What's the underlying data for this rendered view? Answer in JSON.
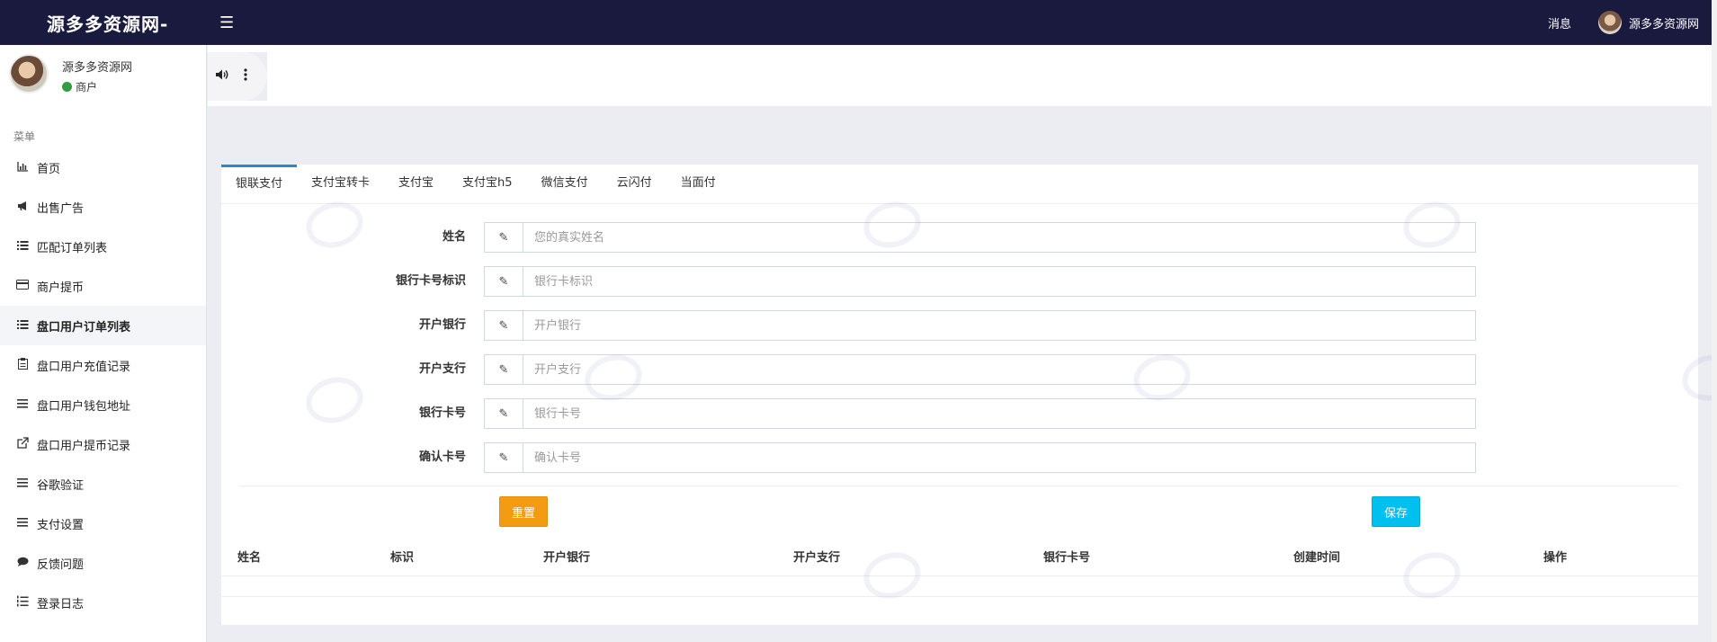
{
  "topbar": {
    "brand": "源多多资源网-",
    "menu_icon": "hamburger-icon",
    "messages": "消息",
    "username": "源多多资源网"
  },
  "sidebar": {
    "user_name": "源多多资源网",
    "user_role": "商户",
    "status_color": "#2e9e3f",
    "menu_header": "菜单",
    "items": [
      {
        "label": "首页",
        "icon": "bar-chart-icon"
      },
      {
        "label": "出售广告",
        "icon": "bullhorn-icon"
      },
      {
        "label": "匹配订单列表",
        "icon": "list-icon"
      },
      {
        "label": "商户提币",
        "icon": "credit-card-icon"
      },
      {
        "label": "盘口用户订单列表",
        "icon": "list-icon"
      },
      {
        "label": "盘口用户充值记录",
        "icon": "clipboard-icon"
      },
      {
        "label": "盘口用户钱包地址",
        "icon": "bars-icon"
      },
      {
        "label": "盘口用户提币记录",
        "icon": "external-link-icon"
      },
      {
        "label": "谷歌验证",
        "icon": "bars-icon"
      },
      {
        "label": "支付设置",
        "icon": "bars-icon"
      },
      {
        "label": "反馈问题",
        "icon": "comment-icon"
      },
      {
        "label": "登录日志",
        "icon": "list-ol-icon"
      }
    ]
  },
  "tabs": [
    "银联支付",
    "支付宝转卡",
    "支付宝",
    "支付宝h5",
    "微信支付",
    "云闪付",
    "当面付"
  ],
  "form": {
    "fields": [
      {
        "label": "姓名",
        "placeholder": "您的真实姓名"
      },
      {
        "label": "银行卡号标识",
        "placeholder": "银行卡标识"
      },
      {
        "label": "开户银行",
        "placeholder": "开户银行"
      },
      {
        "label": "开户支行",
        "placeholder": "开户支行"
      },
      {
        "label": "银行卡号",
        "placeholder": "银行卡号"
      },
      {
        "label": "确认卡号",
        "placeholder": "确认卡号"
      }
    ],
    "reset_label": "重置",
    "save_label": "保存"
  },
  "table": {
    "columns": [
      "姓名",
      "标识",
      "开户银行",
      "开户支行",
      "银行卡号",
      "创建时间",
      "操作"
    ],
    "rows": []
  },
  "colors": {
    "navbar": "#1a1a3e",
    "tab_accent": "#2b8ac5",
    "reset_button": "#f39c12",
    "save_button": "#00c0ef"
  }
}
